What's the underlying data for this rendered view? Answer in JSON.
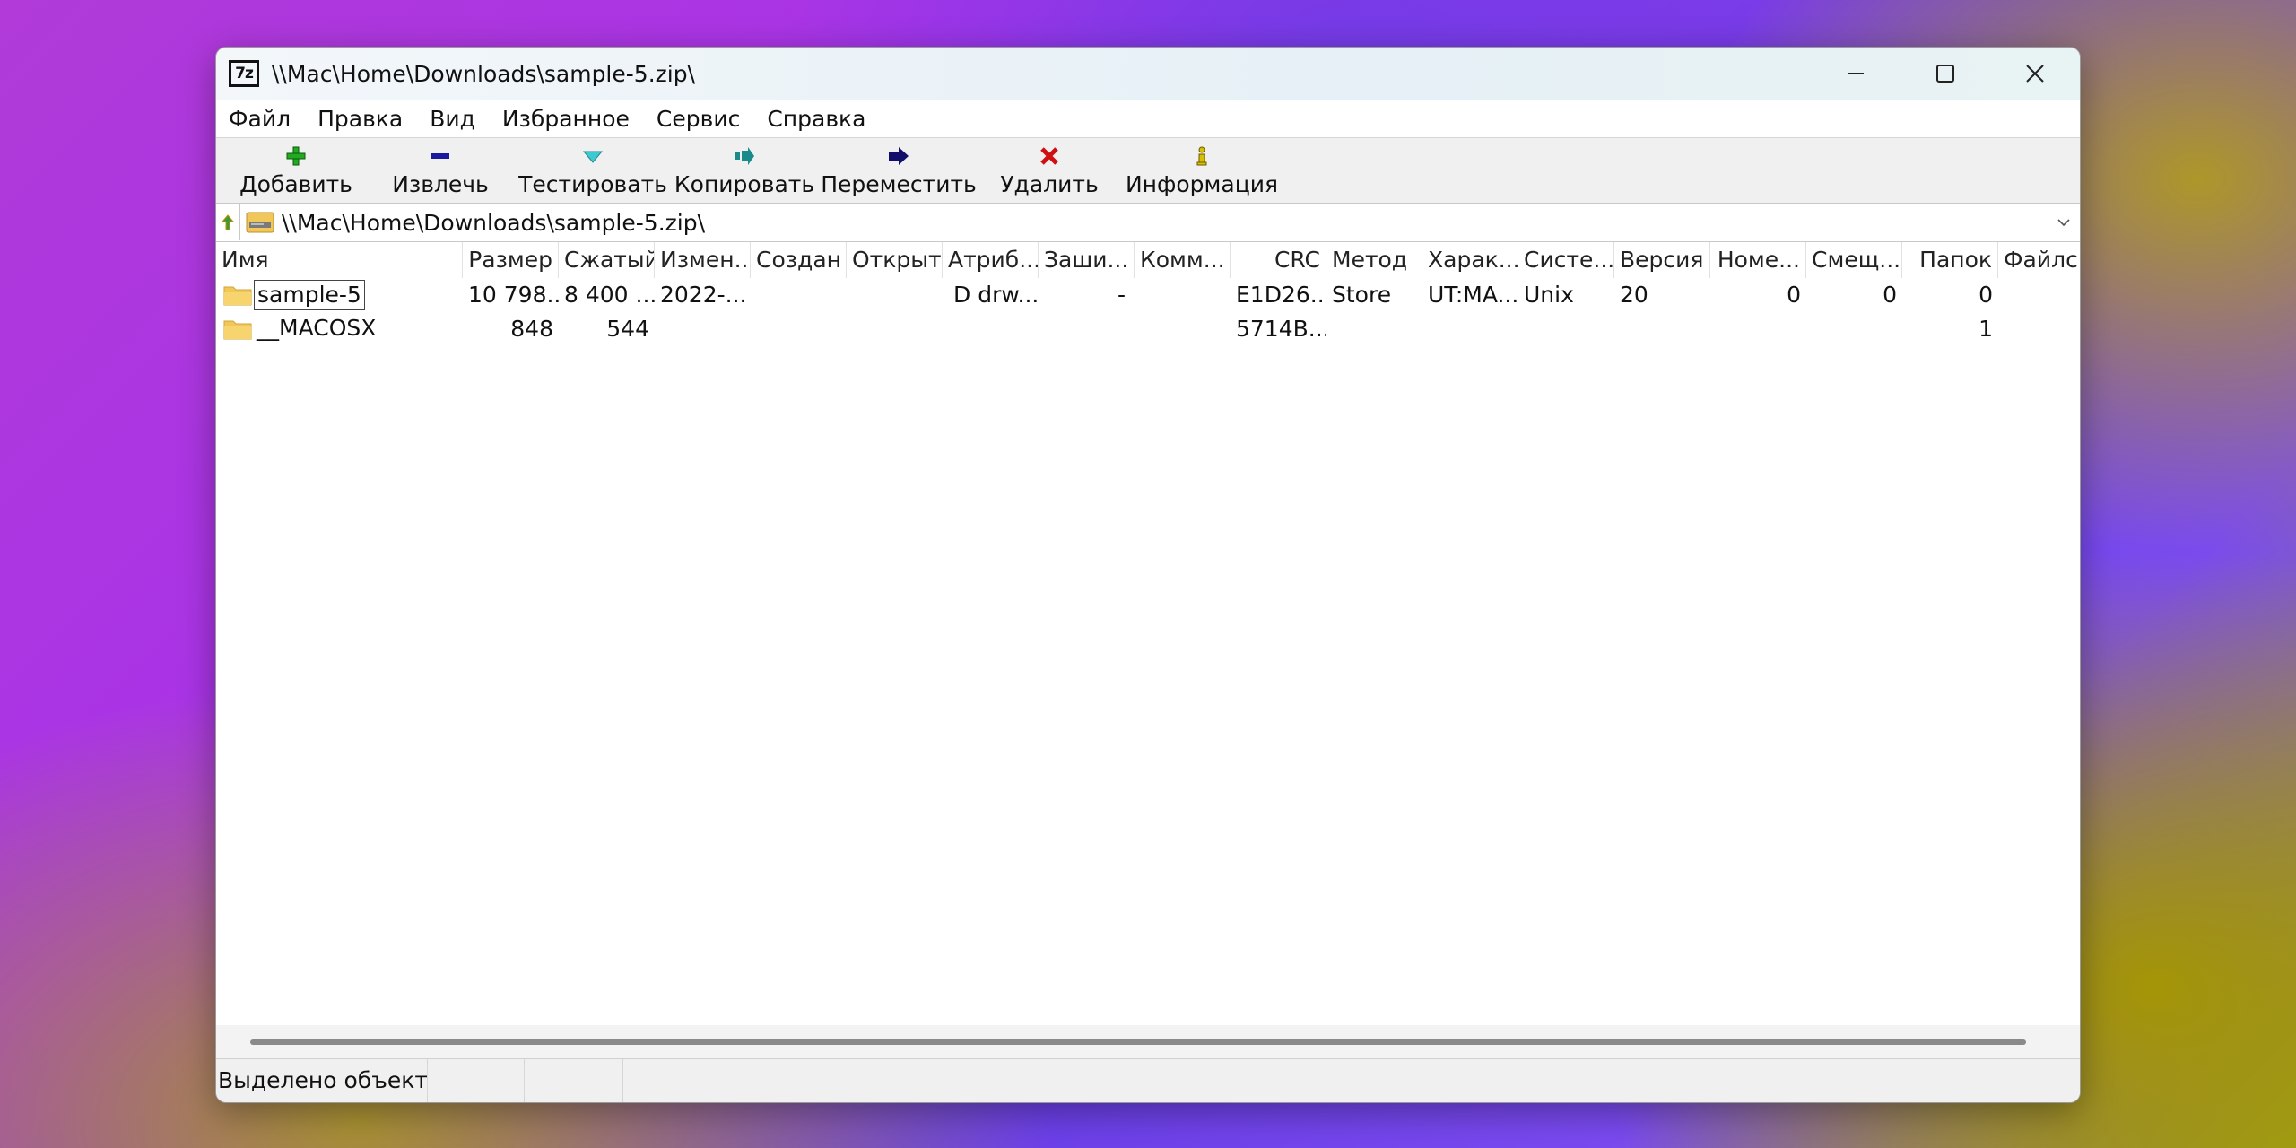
{
  "window": {
    "title": "\\\\Mac\\Home\\Downloads\\sample-5.zip\\",
    "app_icon_text": "7z"
  },
  "menu": [
    "Файл",
    "Правка",
    "Вид",
    "Избранное",
    "Сервис",
    "Справка"
  ],
  "toolbar": {
    "add": "Добавить",
    "extract": "Извлечь",
    "test": "Тестировать",
    "copy": "Копировать",
    "move": "Переместить",
    "delete": "Удалить",
    "info": "Информация"
  },
  "address": {
    "path": "\\\\Mac\\Home\\Downloads\\sample-5.zip\\"
  },
  "columns": [
    "Имя",
    "Размер",
    "Сжатый",
    "Измен...",
    "Создан",
    "Открыт",
    "Атриб...",
    "Заши...",
    "Комм...",
    "CRC",
    "Метод",
    "Харак...",
    "Систе...",
    "Версия",
    "Номе...",
    "Смещ...",
    "Папок",
    "Файлс"
  ],
  "rows": [
    {
      "name": "sample-5",
      "size": "10 798...",
      "packed": "8 400 ...",
      "modified": "2022-...",
      "created": "",
      "accessed": "",
      "attributes": "D drw...",
      "encrypted": "-",
      "comment": "",
      "crc": "E1D26...",
      "method": "Store",
      "characteristics": "UT:MA...",
      "host_os": "Unix",
      "version": "20",
      "volume_index": "0",
      "offset": "0",
      "folders": "0",
      "files": ""
    },
    {
      "name": "__MACOSX",
      "size": "848",
      "packed": "544",
      "modified": "",
      "created": "",
      "accessed": "",
      "attributes": "",
      "encrypted": "",
      "comment": "",
      "crc": "5714B...",
      "method": "",
      "characteristics": "",
      "host_os": "",
      "version": "",
      "volume_index": "",
      "offset": "",
      "folders": "1",
      "files": ""
    }
  ],
  "status": {
    "selected": "Выделено объектов",
    "cell2": "",
    "cell3": ""
  },
  "colors": {
    "add_icon": "#22aa22",
    "extract_icon": "#1a1aa0",
    "test_icon": "#20a0b0",
    "copy_icon": "#1a8a8a",
    "move_icon": "#10106a",
    "delete_icon": "#d01010",
    "info_icon": "#b8a000",
    "folder": "#f2c75a"
  }
}
